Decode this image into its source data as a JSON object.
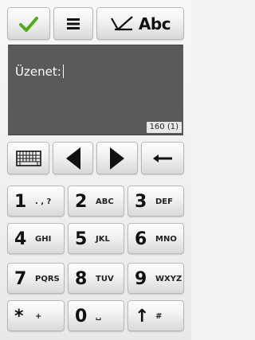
{
  "editor": {
    "label": "Üzenet:",
    "counter": "160 (1)"
  },
  "toolbar": {
    "mode_label": "Abc"
  },
  "keypad": {
    "k1": {
      "num": "1",
      "letters": ". , ?"
    },
    "k2": {
      "num": "2",
      "letters": "ABC"
    },
    "k3": {
      "num": "3",
      "letters": "DEF"
    },
    "k4": {
      "num": "4",
      "letters": "GHI"
    },
    "k5": {
      "num": "5",
      "letters": "JKL"
    },
    "k6": {
      "num": "6",
      "letters": "MNO"
    },
    "k7": {
      "num": "7",
      "letters": "PQRS"
    },
    "k8": {
      "num": "8",
      "letters": "TUV"
    },
    "k9": {
      "num": "9",
      "letters": "WXYZ"
    },
    "kstar": {
      "num": "*",
      "letters": "+"
    },
    "k0": {
      "num": "0",
      "letters": "␣"
    },
    "khash": {
      "num": "↑",
      "letters": "#"
    }
  },
  "colors": {
    "ok_green": "#4cae16",
    "editor_bg": "#5a5a5a"
  }
}
